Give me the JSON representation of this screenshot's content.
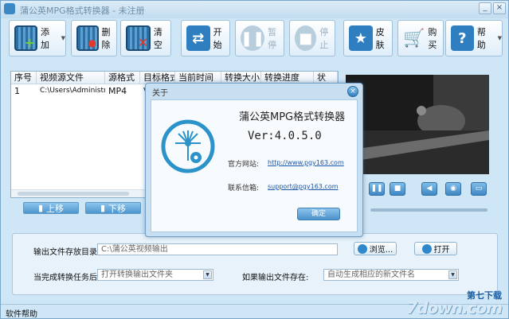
{
  "window": {
    "title": "蒲公英MPG格式转换器 - 未注册",
    "minimize_glyph": "_",
    "close_glyph": "×"
  },
  "toolbar": {
    "add_label": "添加",
    "delete_label": "删除",
    "clear_label": "清空",
    "start_label": "开始",
    "pause_label": "暂停",
    "stop_label": "停止",
    "skin_label": "皮肤",
    "buy_label": "购买",
    "help_label": "帮助"
  },
  "file_list": {
    "columns": [
      "序号",
      "视频源文件",
      "源格式",
      "目标格式",
      "当前时间",
      "转换大小",
      "转换进度",
      "状"
    ],
    "rows": [
      {
        "index": "1",
        "source": "C:\\Users\\Administrat...",
        "src_format": "MP4",
        "dst_format": "V"
      }
    ]
  },
  "list_buttons": {
    "move_up": "上移",
    "move_down": "下移"
  },
  "settings": {
    "output_dir_label": "输出文件存放目录:",
    "output_dir_value": "C:\\蒲公英视频输出",
    "browse_label": "浏览...",
    "open_label": "打开",
    "after_done_label": "当完成转换任务后:",
    "after_done_value": "打开转换输出文件夹",
    "if_exists_label": "如果输出文件存在:",
    "if_exists_value": "自动生成相应的新文件名"
  },
  "statusbar": {
    "text": "软件帮助"
  },
  "watermark": {
    "top": "第七下载",
    "logo": "7down.com"
  },
  "about_dialog": {
    "title": "关于",
    "app_name": "蒲公英MPG格式转换器",
    "version": "Ver:4.0.5.0",
    "website_label": "官方网站:",
    "website_value": "http://www.pgy163.com",
    "email_label": "联系信箱:",
    "email_value": "support@pgy163.com",
    "ok_label": "确定"
  },
  "colors": {
    "accent": "#3b88c4",
    "window_bg": "#cfe6f6",
    "dialog_bg": "#c8dff1"
  }
}
